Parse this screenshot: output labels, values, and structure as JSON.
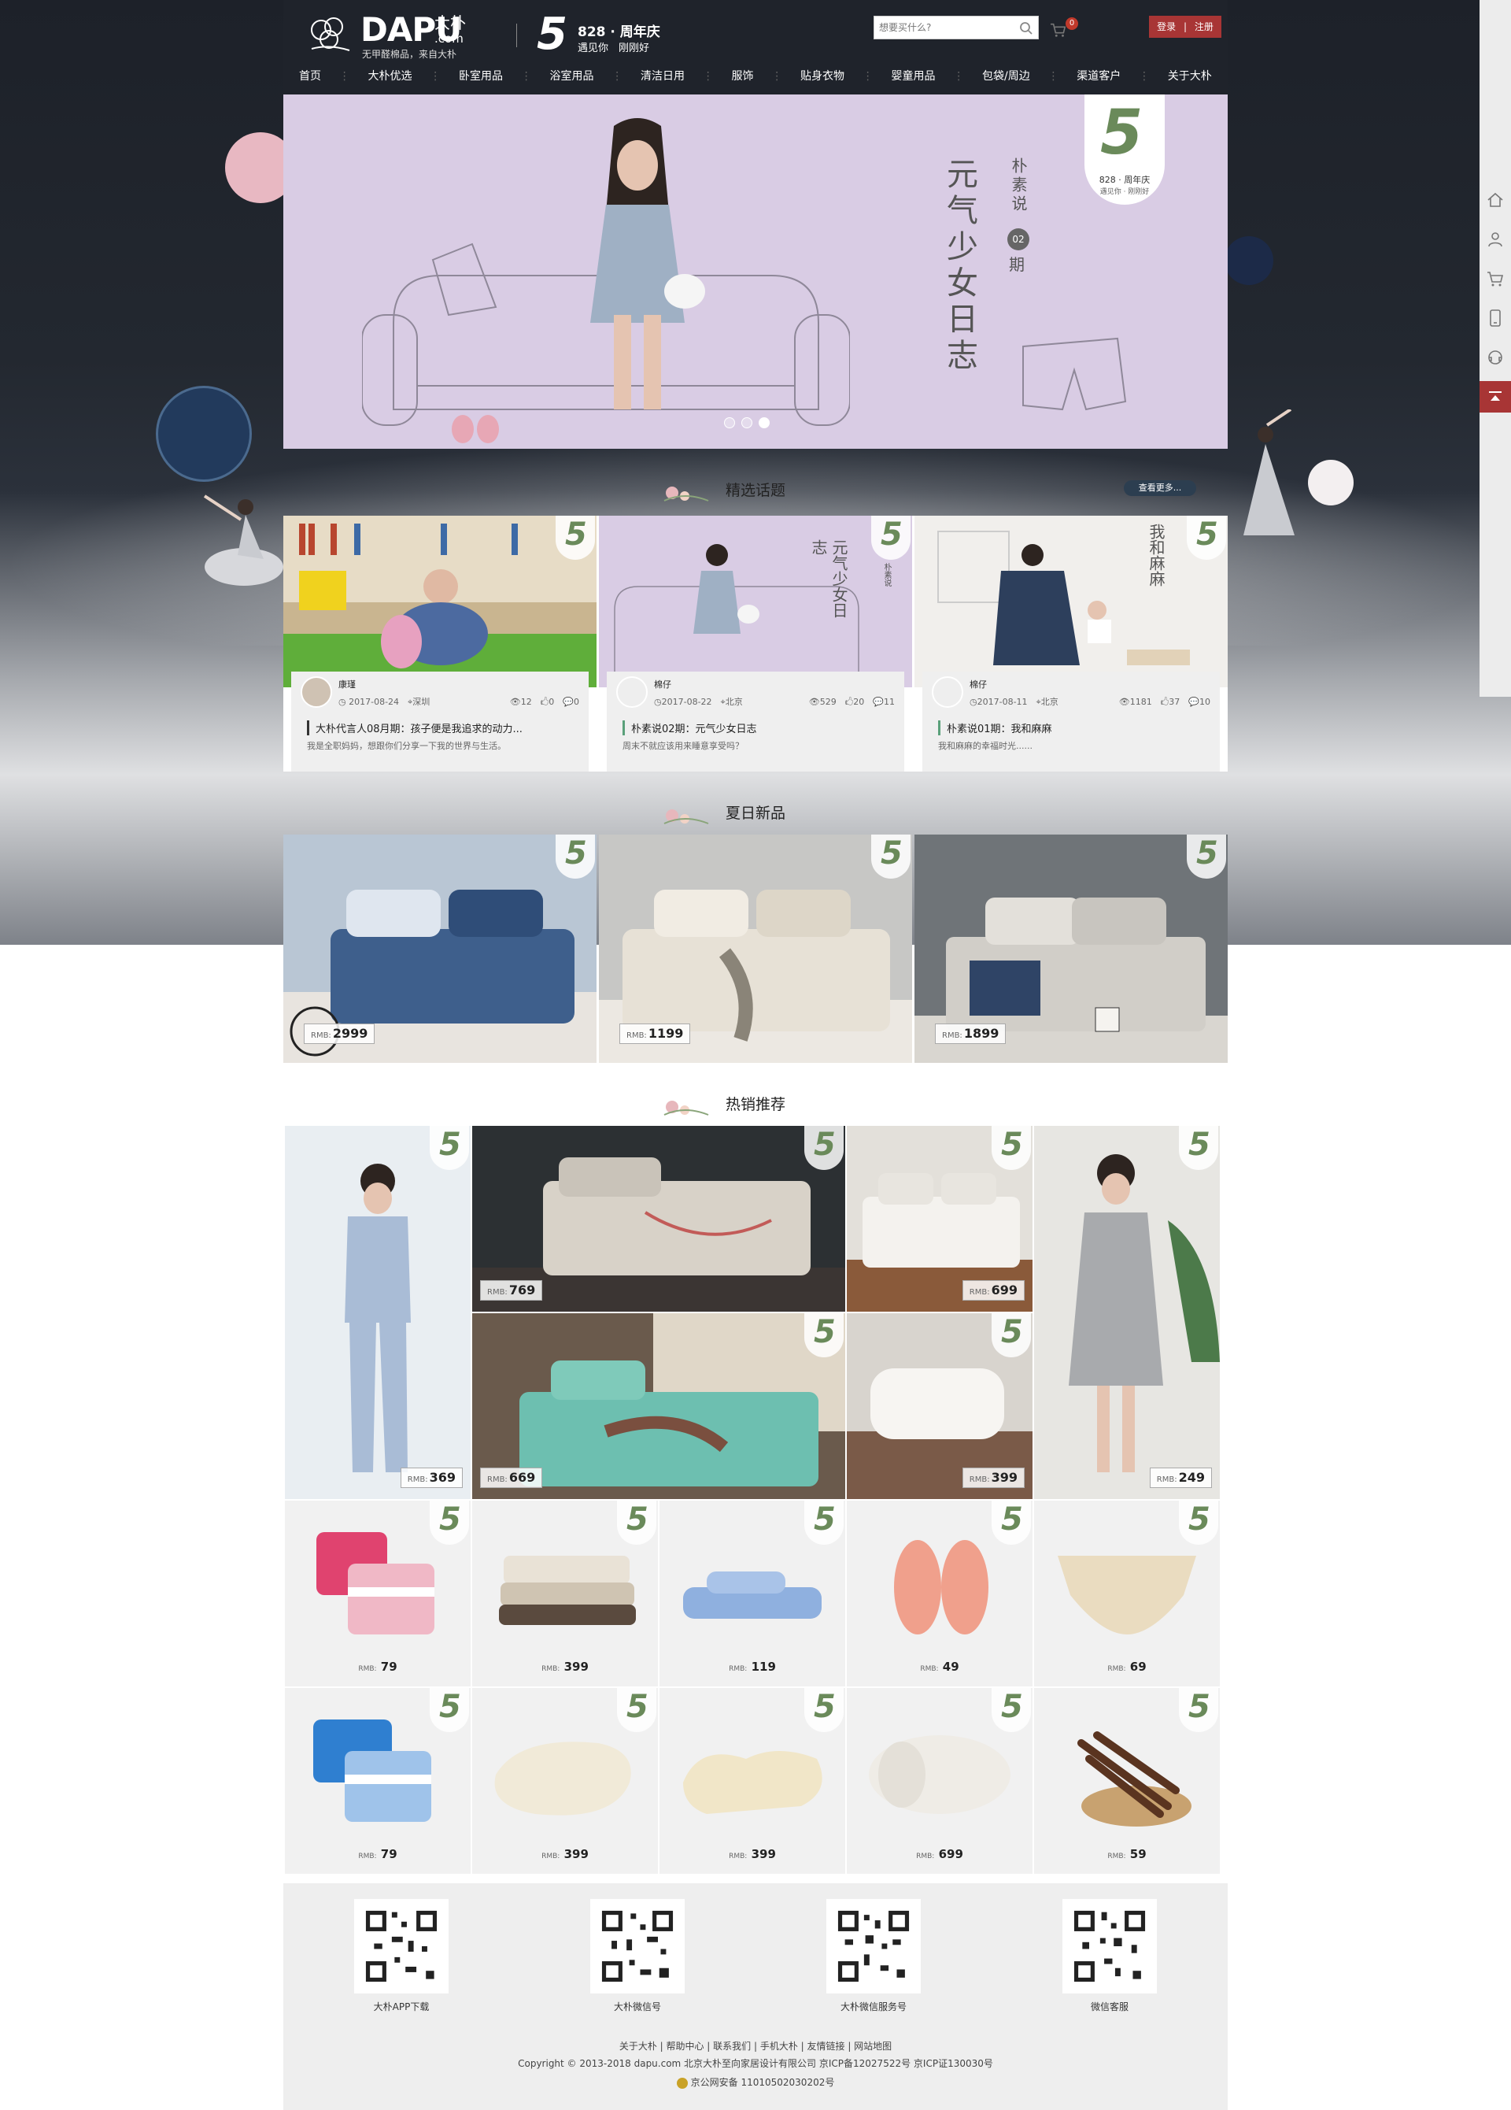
{
  "header": {
    "logo_word": "DAPU",
    "logo_cn": "大朴",
    "logo_com": ".com",
    "logo_slogan": "无甲醛棉品，来自大朴",
    "anniv_num": "5",
    "anniv_title": "828 · 周年庆",
    "anniv_sub": "遇见你　刚刚好",
    "search_placeholder": "想要买什么?",
    "cart_count": "0",
    "login": "登录",
    "auth_sep": "|",
    "register": "注册"
  },
  "nav": [
    "首页",
    "大朴优选",
    "卧室用品",
    "浴室用品",
    "清洁日用",
    "服饰",
    "贴身衣物",
    "婴童用品",
    "包袋/周边",
    "渠道客户",
    "关于大朴"
  ],
  "banner": {
    "title_vertical": "元气少女日志",
    "series": "朴素说",
    "issue_no": "02",
    "issue_unit": "期",
    "badge_num": "5",
    "badge_text": "828 · 周年庆",
    "badge_sub": "遇见你 · 刚刚好"
  },
  "topics_section": {
    "title": "精选话题",
    "more": "查看更多..."
  },
  "topics": [
    {
      "author": "康瑾",
      "date": "2017-08-24",
      "city": "深圳",
      "views": "12",
      "likes": "0",
      "comments": "0",
      "title": "大朴代言人08月期：孩子便是我追求的动力...",
      "desc": "我是全职妈妈，想跟你们分享一下我的世界与生活。"
    },
    {
      "author": "棉仔",
      "date": "2017-08-22",
      "city": "北京",
      "views": "529",
      "likes": "20",
      "comments": "11",
      "title": "朴素说02期：元气少女日志",
      "desc": "周末不就应该用来睡意享受吗？"
    },
    {
      "author": "棉仔",
      "date": "2017-08-11",
      "city": "北京",
      "views": "1181",
      "likes": "37",
      "comments": "10",
      "title": "朴素说01期：我和麻麻",
      "desc": "我和麻麻的幸福时光......"
    }
  ],
  "topic_thumbs": {
    "t2_title": "元气少女日志",
    "t3_title": "我和麻麻",
    "series": "朴素说"
  },
  "summer_section": {
    "title": "夏日新品"
  },
  "summer_items": [
    {
      "price": "2999"
    },
    {
      "price": "1199"
    },
    {
      "price": "1899"
    }
  ],
  "hot_section": {
    "title": "热销推荐"
  },
  "currency": "RMB:",
  "hot_items": [
    {
      "id": "pajama-man",
      "price": "369"
    },
    {
      "id": "bed-dark",
      "price": "769"
    },
    {
      "id": "bed-wood",
      "price": "699"
    },
    {
      "id": "dress-woman",
      "price": "249"
    },
    {
      "id": "bed-teal",
      "price": "669"
    },
    {
      "id": "pillow",
      "price": "399"
    },
    {
      "id": "towels-pink",
      "price": "79"
    },
    {
      "id": "blanket-stack",
      "price": "399"
    },
    {
      "id": "towel-blue",
      "price": "119"
    },
    {
      "id": "slippers",
      "price": "49"
    },
    {
      "id": "underwear",
      "price": "69"
    },
    {
      "id": "towels-blue",
      "price": "79"
    },
    {
      "id": "latex-pillow",
      "price": "399"
    },
    {
      "id": "contour-pillow",
      "price": "399"
    },
    {
      "id": "quilt-roll",
      "price": "699"
    },
    {
      "id": "cinnamon",
      "price": "59"
    }
  ],
  "footer": {
    "qr_captions": [
      "大朴APP下载",
      "大朴微信号",
      "大朴微信服务号",
      "微信客服"
    ],
    "links": "关于大朴 | 帮助中心 | 联系我们 | 手机大朴 | 友情链接 | 网站地图",
    "copyright": "Copyright © 2013-2018 dapu.com 北京大朴至向家居设计有限公司 京ICP备12027522号 京ICP证130030号",
    "icp": "京公网安备 11010502030202号"
  },
  "colors": {
    "accent": "#a83535",
    "header_bg": "#1f232b",
    "banner_bg": "#d9cce4"
  },
  "rail_icons": [
    "home-icon",
    "user-icon",
    "cart-icon",
    "phone-icon",
    "service-icon",
    "back-to-top-icon"
  ]
}
